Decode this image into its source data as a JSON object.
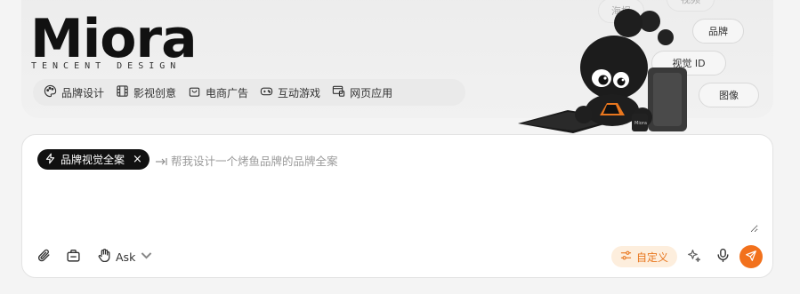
{
  "brand": {
    "logo_text": "Miora",
    "subtitle": "TENCENT DESIGN"
  },
  "categories": [
    {
      "label": "品牌设计",
      "icon": "palette-icon"
    },
    {
      "label": "影视创意",
      "icon": "film-icon"
    },
    {
      "label": "电商广告",
      "icon": "shopping-bag-icon"
    },
    {
      "label": "互动游戏",
      "icon": "gamepad-icon"
    },
    {
      "label": "网页应用",
      "icon": "web-app-icon"
    }
  ],
  "floating_tags": {
    "poster": "海报",
    "video": "视频",
    "brand": "品牌",
    "visual_id": "视觉 ID",
    "image": "图像"
  },
  "input": {
    "mode_chip": "品牌视觉全案",
    "chip_icon": "lightning-icon",
    "close_glyph": "×",
    "placeholder": "帮我设计一个烤鱼品牌的品牌全案",
    "value": ""
  },
  "toolbar": {
    "ask_label": "Ask",
    "custom_label": "自定义",
    "attach_icon": "paperclip-icon",
    "plugin_icon": "toolbox-icon",
    "hand_icon": "hand-icon",
    "sparkle_icon": "sparkle-icon",
    "mic_icon": "microphone-icon",
    "send_icon": "send-icon"
  },
  "colors": {
    "accent": "#f2711c",
    "accent_soft": "#fdeedd",
    "chip_bg": "#111111"
  }
}
